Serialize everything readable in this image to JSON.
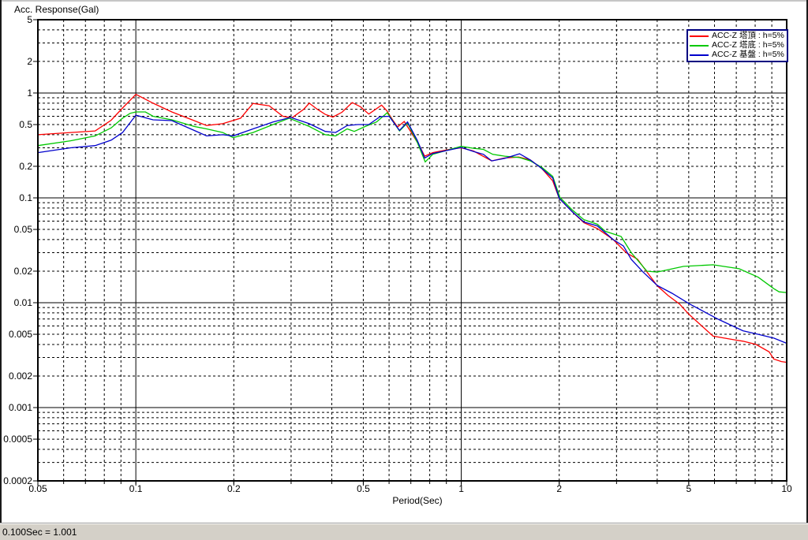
{
  "window": {
    "status_text": "0.100Sec = 1.001"
  },
  "chart_data": {
    "type": "line",
    "title": "Acc. Response(Gal)",
    "xlabel": "Period(Sec)",
    "ylabel": "Acc. Response(Gal)",
    "x_scale": "log",
    "y_scale": "log",
    "xlim": [
      0.05,
      10
    ],
    "ylim": [
      0.0002,
      5
    ],
    "grid": "full log grid: solid black lines at decade values, dashed black lines at minor mantissas",
    "legend_position": "top-right",
    "legend_border_color": "#000080",
    "x_ticks": [
      {
        "label": "0.05",
        "value": 0.05
      },
      {
        "label": "0.1",
        "value": 0.1
      },
      {
        "label": "0.2",
        "value": 0.2
      },
      {
        "label": "0.5",
        "value": 0.5
      },
      {
        "label": "1",
        "value": 1
      },
      {
        "label": "2",
        "value": 2
      },
      {
        "label": "5",
        "value": 5
      },
      {
        "label": "10",
        "value": 10
      }
    ],
    "y_ticks": [
      {
        "label": "5",
        "value": 5
      },
      {
        "label": "2",
        "value": 2
      },
      {
        "label": "1",
        "value": 1
      },
      {
        "label": "0.5",
        "value": 0.5
      },
      {
        "label": "0.2",
        "value": 0.2
      },
      {
        "label": "0.1",
        "value": 0.1
      },
      {
        "label": "0.05",
        "value": 0.05
      },
      {
        "label": "0.02",
        "value": 0.02
      },
      {
        "label": "0.01",
        "value": 0.01
      },
      {
        "label": "0.005",
        "value": 0.005
      },
      {
        "label": "0.002",
        "value": 0.002
      },
      {
        "label": "0.001",
        "value": 0.001
      },
      {
        "label": "0.0005",
        "value": 0.0005
      },
      {
        "label": "0.0002",
        "value": 0.0002
      }
    ],
    "series": [
      {
        "name": "ACC-Z 塔頂 : h=5%",
        "color": "#ff0000",
        "points": [
          [
            0.05,
            0.4
          ],
          [
            0.063,
            0.42
          ],
          [
            0.075,
            0.435
          ],
          [
            0.084,
            0.55
          ],
          [
            0.091,
            0.72
          ],
          [
            0.1,
            0.97
          ],
          [
            0.113,
            0.8
          ],
          [
            0.129,
            0.66
          ],
          [
            0.151,
            0.545
          ],
          [
            0.165,
            0.49
          ],
          [
            0.185,
            0.51
          ],
          [
            0.21,
            0.575
          ],
          [
            0.229,
            0.795
          ],
          [
            0.257,
            0.755
          ],
          [
            0.283,
            0.6
          ],
          [
            0.302,
            0.58
          ],
          [
            0.328,
            0.7
          ],
          [
            0.341,
            0.8
          ],
          [
            0.361,
            0.7
          ],
          [
            0.382,
            0.625
          ],
          [
            0.403,
            0.59
          ],
          [
            0.43,
            0.655
          ],
          [
            0.462,
            0.81
          ],
          [
            0.49,
            0.74
          ],
          [
            0.52,
            0.63
          ],
          [
            0.569,
            0.765
          ],
          [
            0.59,
            0.68
          ],
          [
            0.615,
            0.555
          ],
          [
            0.637,
            0.475
          ],
          [
            0.668,
            0.535
          ],
          [
            0.709,
            0.4
          ],
          [
            0.745,
            0.31
          ],
          [
            0.772,
            0.25
          ],
          [
            0.817,
            0.27
          ],
          [
            0.919,
            0.29
          ],
          [
            1.0,
            0.3
          ],
          [
            1.09,
            0.28
          ],
          [
            1.24,
            0.225
          ],
          [
            1.36,
            0.24
          ],
          [
            1.5,
            0.245
          ],
          [
            1.63,
            0.23
          ],
          [
            1.77,
            0.19
          ],
          [
            1.91,
            0.145
          ],
          [
            2.0,
            0.099
          ],
          [
            2.19,
            0.074
          ],
          [
            2.38,
            0.058
          ],
          [
            2.62,
            0.051
          ],
          [
            2.93,
            0.04
          ],
          [
            3.21,
            0.03
          ],
          [
            3.48,
            0.026
          ],
          [
            4.0,
            0.0145
          ],
          [
            4.32,
            0.0117
          ],
          [
            4.69,
            0.0097
          ],
          [
            5.0,
            0.0078
          ],
          [
            5.94,
            0.0048
          ],
          [
            6.98,
            0.0044
          ],
          [
            7.34,
            0.0043
          ],
          [
            8.05,
            0.004
          ],
          [
            8.83,
            0.0034
          ],
          [
            9.13,
            0.0029
          ],
          [
            9.63,
            0.00275
          ],
          [
            10,
            0.0027
          ]
        ]
      },
      {
        "name": "ACC-Z 塔底 : h=5%",
        "color": "#00c800",
        "points": [
          [
            0.05,
            0.315
          ],
          [
            0.063,
            0.35
          ],
          [
            0.075,
            0.39
          ],
          [
            0.084,
            0.465
          ],
          [
            0.091,
            0.575
          ],
          [
            0.096,
            0.64
          ],
          [
            0.1,
            0.66
          ],
          [
            0.107,
            0.66
          ],
          [
            0.113,
            0.6
          ],
          [
            0.129,
            0.555
          ],
          [
            0.151,
            0.48
          ],
          [
            0.165,
            0.455
          ],
          [
            0.185,
            0.42
          ],
          [
            0.199,
            0.375
          ],
          [
            0.229,
            0.42
          ],
          [
            0.264,
            0.5
          ],
          [
            0.296,
            0.575
          ],
          [
            0.341,
            0.48
          ],
          [
            0.382,
            0.4
          ],
          [
            0.411,
            0.39
          ],
          [
            0.446,
            0.455
          ],
          [
            0.469,
            0.43
          ],
          [
            0.507,
            0.48
          ],
          [
            0.549,
            0.53
          ],
          [
            0.592,
            0.648
          ],
          [
            0.646,
            0.435
          ],
          [
            0.684,
            0.52
          ],
          [
            0.732,
            0.34
          ],
          [
            0.775,
            0.22
          ],
          [
            0.817,
            0.26
          ],
          [
            1.0,
            0.31
          ],
          [
            1.09,
            0.297
          ],
          [
            1.17,
            0.29
          ],
          [
            1.25,
            0.26
          ],
          [
            1.36,
            0.25
          ],
          [
            1.51,
            0.242
          ],
          [
            1.63,
            0.225
          ],
          [
            1.77,
            0.195
          ],
          [
            1.91,
            0.16
          ],
          [
            2.01,
            0.101
          ],
          [
            2.19,
            0.077
          ],
          [
            2.38,
            0.062
          ],
          [
            2.62,
            0.056
          ],
          [
            2.77,
            0.048
          ],
          [
            3.1,
            0.0428
          ],
          [
            3.33,
            0.03
          ],
          [
            3.72,
            0.02
          ],
          [
            4.0,
            0.0196
          ],
          [
            4.82,
            0.0222
          ],
          [
            5.94,
            0.023
          ],
          [
            7.14,
            0.0211
          ],
          [
            8.18,
            0.0175
          ],
          [
            9.13,
            0.0136
          ],
          [
            9.48,
            0.0127
          ],
          [
            10,
            0.0125
          ]
        ]
      },
      {
        "name": "ACC-Z 基盤 : h=5%",
        "color": "#0000cc",
        "points": [
          [
            0.05,
            0.27
          ],
          [
            0.063,
            0.3
          ],
          [
            0.075,
            0.315
          ],
          [
            0.084,
            0.355
          ],
          [
            0.091,
            0.42
          ],
          [
            0.1,
            0.615
          ],
          [
            0.107,
            0.58
          ],
          [
            0.113,
            0.555
          ],
          [
            0.129,
            0.545
          ],
          [
            0.151,
            0.44
          ],
          [
            0.165,
            0.39
          ],
          [
            0.185,
            0.4
          ],
          [
            0.199,
            0.39
          ],
          [
            0.229,
            0.455
          ],
          [
            0.264,
            0.53
          ],
          [
            0.299,
            0.585
          ],
          [
            0.341,
            0.51
          ],
          [
            0.382,
            0.43
          ],
          [
            0.411,
            0.42
          ],
          [
            0.446,
            0.49
          ],
          [
            0.481,
            0.5
          ],
          [
            0.52,
            0.5
          ],
          [
            0.563,
            0.595
          ],
          [
            0.6,
            0.6
          ],
          [
            0.646,
            0.44
          ],
          [
            0.684,
            0.53
          ],
          [
            0.732,
            0.355
          ],
          [
            0.772,
            0.24
          ],
          [
            0.817,
            0.265
          ],
          [
            1.0,
            0.303
          ],
          [
            1.09,
            0.277
          ],
          [
            1.17,
            0.26
          ],
          [
            1.24,
            0.225
          ],
          [
            1.36,
            0.238
          ],
          [
            1.51,
            0.263
          ],
          [
            1.63,
            0.23
          ],
          [
            1.77,
            0.19
          ],
          [
            1.91,
            0.155
          ],
          [
            2.0,
            0.099
          ],
          [
            2.19,
            0.074
          ],
          [
            2.38,
            0.059
          ],
          [
            2.62,
            0.054
          ],
          [
            2.93,
            0.04
          ],
          [
            3.15,
            0.0347
          ],
          [
            3.33,
            0.0259
          ],
          [
            3.62,
            0.0196
          ],
          [
            4.0,
            0.0146
          ],
          [
            4.44,
            0.0123
          ],
          [
            5.04,
            0.0097
          ],
          [
            6.19,
            0.0069
          ],
          [
            7.34,
            0.0054
          ],
          [
            8.18,
            0.005
          ],
          [
            9.13,
            0.0046
          ],
          [
            10,
            0.0041
          ]
        ]
      }
    ]
  }
}
